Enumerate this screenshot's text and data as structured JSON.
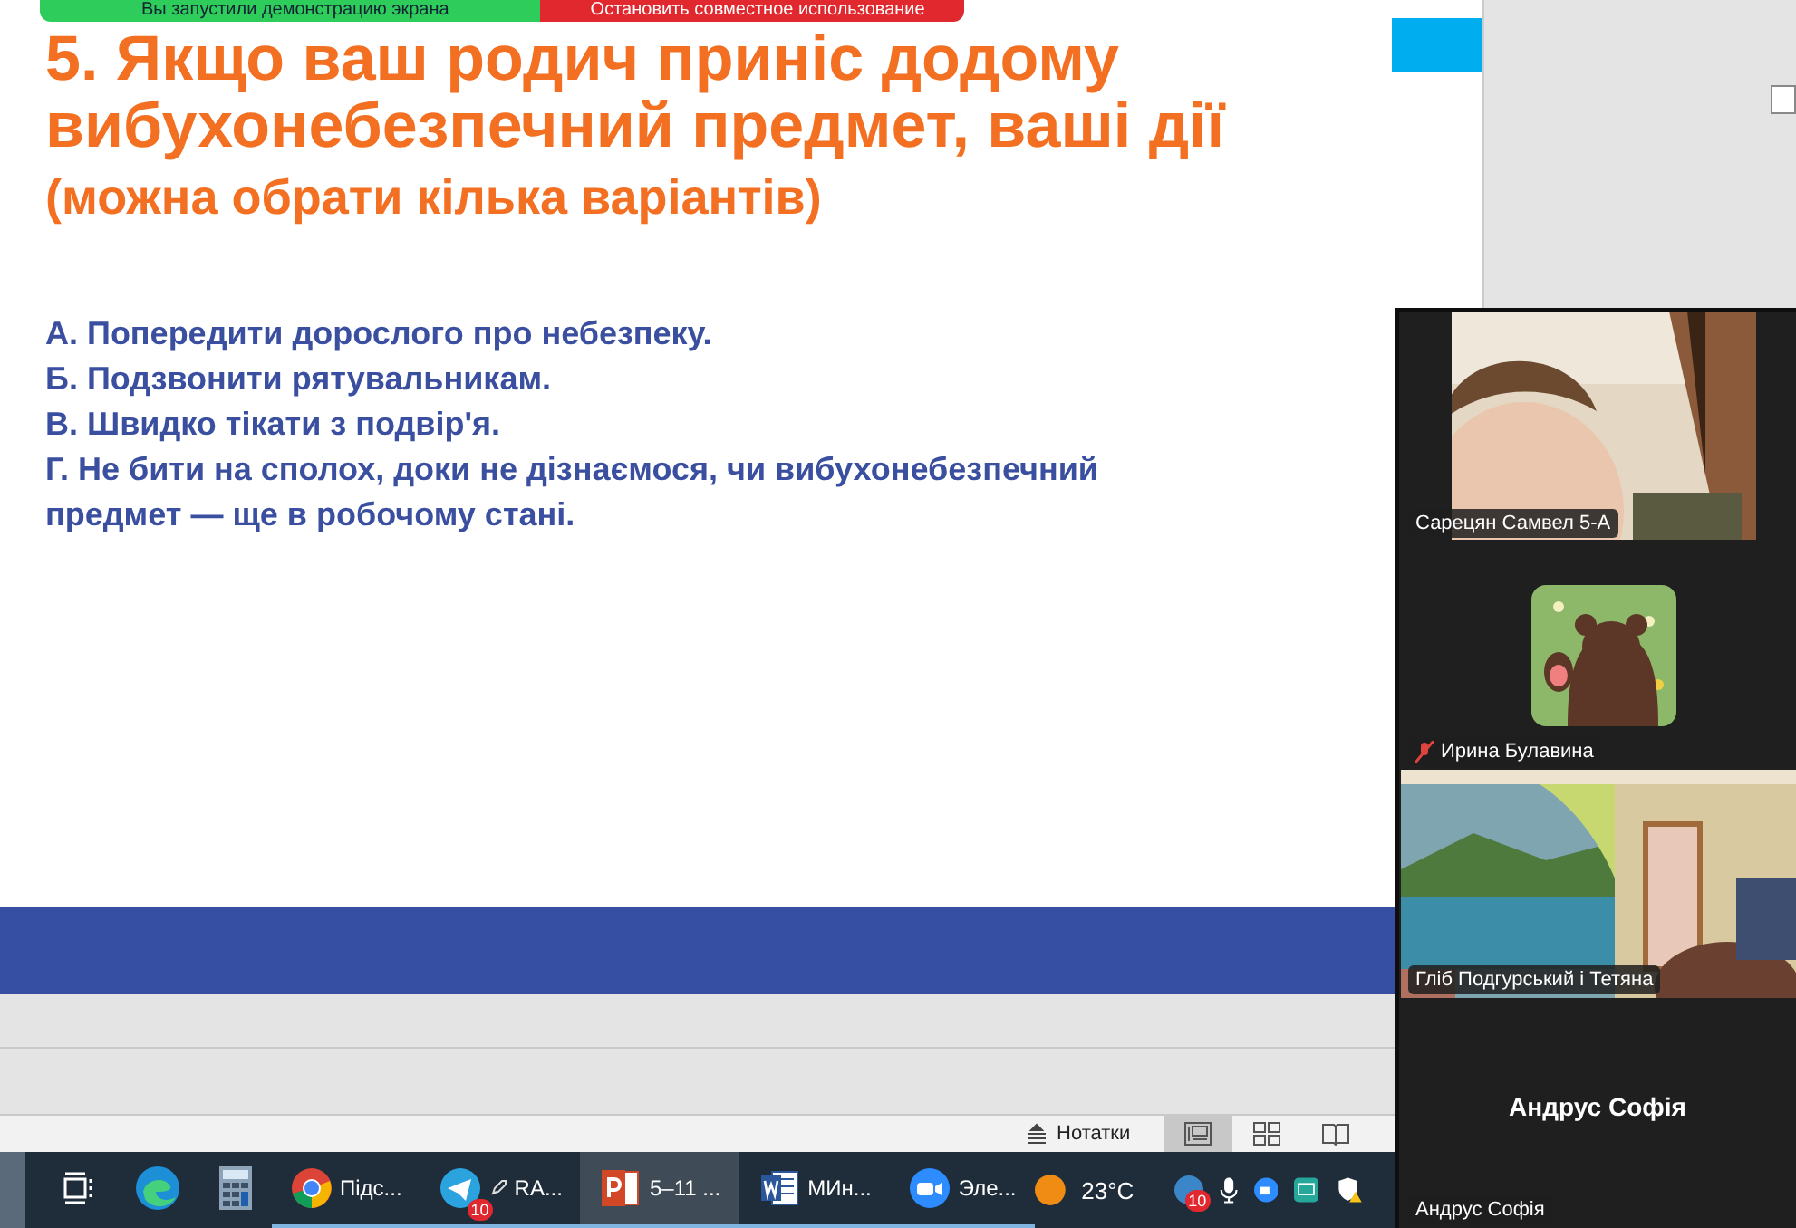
{
  "share_bar": {
    "status": "Вы запустили демонстрацию экрана",
    "stop_button": "Остановить совместное использование"
  },
  "slide": {
    "title": "5. Якщо ваш родич приніс додому вибухонебезпечний предмет, ваші дії",
    "title_note": "(можна обрати кілька варіантів)",
    "options": [
      "А. Попередити дорослого про небезпеку.",
      "Б. Подзвонити рятувальникам.",
      "В. Швидко тікати з подвір'я.",
      "Г. Не бити на сполох, доки не дізнаємося, чи вибухонебезпечний предмет — ще в робочому стані."
    ]
  },
  "status_bar": {
    "notes_button": "Нотатки",
    "views": [
      {
        "kind": "normal",
        "selected": true
      },
      {
        "kind": "sorter",
        "selected": false
      },
      {
        "kind": "reading",
        "selected": false
      }
    ]
  },
  "taskbar": {
    "apps": [
      {
        "kind": "taskview",
        "active": false
      },
      {
        "kind": "edge",
        "active": false
      },
      {
        "kind": "calculator",
        "active": false
      },
      {
        "kind": "chrome",
        "label": "Підс...",
        "active": false
      },
      {
        "kind": "telegram",
        "label": "RA...",
        "badge": "10",
        "active": false
      },
      {
        "kind": "powerpoint",
        "label": "5–11 ...",
        "active": true
      },
      {
        "kind": "word",
        "label": "МИн...",
        "active": false
      },
      {
        "kind": "zoom",
        "label": "Эле...",
        "active": false
      }
    ],
    "weather": "23°C",
    "tray_badge": "10"
  },
  "participants": [
    {
      "kind": "video",
      "name": "Сарецян Самвел 5-А",
      "muted": false
    },
    {
      "kind": "avatar",
      "name": "Ирина Булавина",
      "muted": true
    },
    {
      "kind": "video",
      "name": "Гліб Подгурський і Тетяна",
      "muted": false
    },
    {
      "kind": "name_only",
      "display": "Андрус Софія",
      "name": "Андрус Софія",
      "muted": false
    }
  ]
}
